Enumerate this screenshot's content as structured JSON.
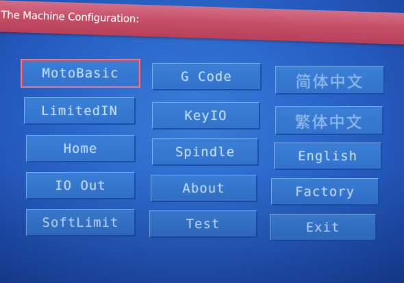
{
  "window": {
    "title": "The Machine Configuration:"
  },
  "colors": {
    "title_bar": "#c75069",
    "background": "#2c6acd",
    "button_face": "#3373cd",
    "button_text": "#bfdcff",
    "selection_border": "#d87a96"
  },
  "buttons": {
    "motobasic": "MotoBasic",
    "limitedin": "LimitedIN",
    "home": "Home",
    "io_out": "IO Out",
    "softlimit": "SoftLimit",
    "gcode": "G Code",
    "keyio": "KeyIO",
    "spindle": "Spindle",
    "about": "About",
    "test": "Test",
    "simplified_chinese": "简体中文",
    "traditional_chinese": "繁体中文",
    "english": "English",
    "factory": "Factory",
    "exit": "Exit"
  },
  "selected_button": "MotoBasic"
}
